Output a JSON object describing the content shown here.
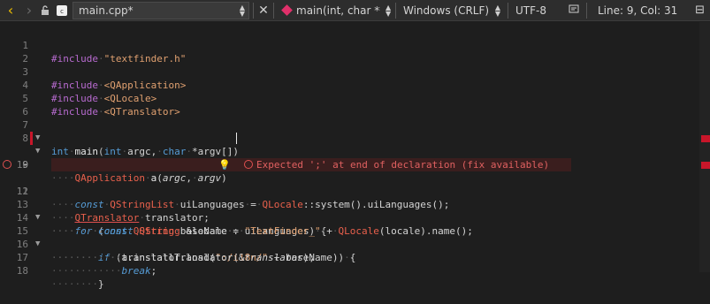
{
  "toolbar": {
    "back_icon": "chevron-left-icon",
    "forward_icon": "chevron-right-icon",
    "file_name": "main.cpp*",
    "symbol": "main(int, char **...",
    "line_endings": "Windows (CRLF)",
    "encoding": "UTF-8",
    "position": "Line: 9, Col: 31"
  },
  "editor": {
    "current_line": 9,
    "error_line": 11,
    "error_message": "Expected ';' at end of declaration (fix available)",
    "line_numbers": [
      "1",
      "2",
      "3",
      "4",
      "5",
      "6",
      "7",
      "8",
      "9",
      "10",
      "11",
      "12",
      "13",
      "14",
      "15",
      "16",
      "17",
      "18"
    ]
  },
  "colors": {
    "accent": "#f0c000",
    "error": "#e05050",
    "type": "#e8604c",
    "keyword": "#569cd6",
    "preprocessor": "#b86bd0",
    "string": "#e0a070"
  }
}
